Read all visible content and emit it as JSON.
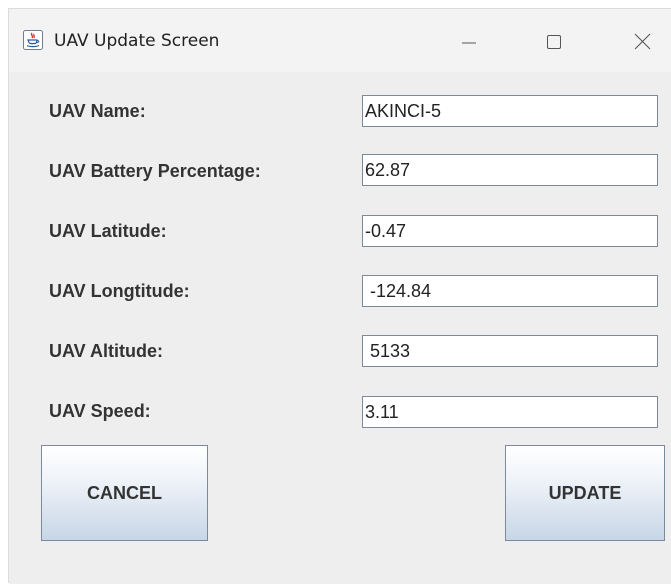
{
  "window": {
    "title": "UAV Update Screen"
  },
  "form": {
    "fields": [
      {
        "label": "UAV Name:",
        "value": "AKINCI-5"
      },
      {
        "label": "UAV Battery Percentage:",
        "value": "62.87"
      },
      {
        "label": "UAV Latitude:",
        "value": "-0.47"
      },
      {
        "label": "UAV Longtitude:",
        "value": " -124.84"
      },
      {
        "label": "UAV Altitude:",
        "value": " 5133"
      },
      {
        "label": "UAV Speed:",
        "value": "3.11"
      }
    ]
  },
  "buttons": {
    "cancel_label": "CANCEL",
    "update_label": "UPDATE"
  },
  "icons": {
    "app": "java-icon",
    "minimize": "minimize-icon",
    "maximize": "maximize-icon",
    "close": "close-icon"
  },
  "colors": {
    "window_background": "#eeeeee",
    "titlebar_background": "#f3f3f3",
    "field_border": "#7a8a9a",
    "button_gradient_bottom": "#c7d6e6",
    "java_icon_red": "#e32b2b",
    "java_icon_blue": "#2b5d9c"
  }
}
